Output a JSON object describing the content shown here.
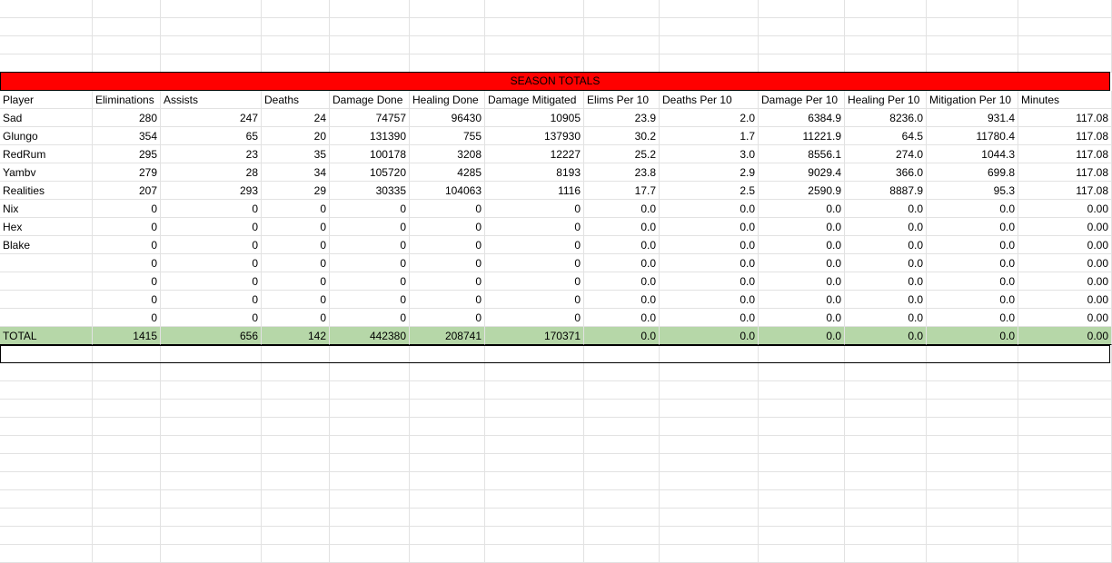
{
  "banner": "SEASON TOTALS",
  "headers": [
    "Player",
    "Eliminations",
    "Assists",
    "Deaths",
    "Damage Done",
    "Healing Done",
    "Damage Mitigated",
    "Elims Per 10",
    "Deaths Per 10",
    "Damage Per 10",
    "Healing Per 10",
    "Mitigation Per 10",
    "Minutes"
  ],
  "rows": [
    [
      "Sad",
      "280",
      "247",
      "24",
      "74757",
      "96430",
      "10905",
      "23.9",
      "2.0",
      "6384.9",
      "8236.0",
      "931.4",
      "117.08"
    ],
    [
      "Glungo",
      "354",
      "65",
      "20",
      "131390",
      "755",
      "137930",
      "30.2",
      "1.7",
      "11221.9",
      "64.5",
      "11780.4",
      "117.08"
    ],
    [
      "RedRum",
      "295",
      "23",
      "35",
      "100178",
      "3208",
      "12227",
      "25.2",
      "3.0",
      "8556.1",
      "274.0",
      "1044.3",
      "117.08"
    ],
    [
      "Yambv",
      "279",
      "28",
      "34",
      "105720",
      "4285",
      "8193",
      "23.8",
      "2.9",
      "9029.4",
      "366.0",
      "699.8",
      "117.08"
    ],
    [
      "Realities",
      "207",
      "293",
      "29",
      "30335",
      "104063",
      "1116",
      "17.7",
      "2.5",
      "2590.9",
      "8887.9",
      "95.3",
      "117.08"
    ],
    [
      "Nix",
      "0",
      "0",
      "0",
      "0",
      "0",
      "0",
      "0.0",
      "0.0",
      "0.0",
      "0.0",
      "0.0",
      "0.00"
    ],
    [
      "Hex",
      "0",
      "0",
      "0",
      "0",
      "0",
      "0",
      "0.0",
      "0.0",
      "0.0",
      "0.0",
      "0.0",
      "0.00"
    ],
    [
      "Blake",
      "0",
      "0",
      "0",
      "0",
      "0",
      "0",
      "0.0",
      "0.0",
      "0.0",
      "0.0",
      "0.0",
      "0.00"
    ],
    [
      "",
      "0",
      "0",
      "0",
      "0",
      "0",
      "0",
      "0.0",
      "0.0",
      "0.0",
      "0.0",
      "0.0",
      "0.00"
    ],
    [
      "",
      "0",
      "0",
      "0",
      "0",
      "0",
      "0",
      "0.0",
      "0.0",
      "0.0",
      "0.0",
      "0.0",
      "0.00"
    ],
    [
      "",
      "0",
      "0",
      "0",
      "0",
      "0",
      "0",
      "0.0",
      "0.0",
      "0.0",
      "0.0",
      "0.0",
      "0.00"
    ],
    [
      "",
      "0",
      "0",
      "0",
      "0",
      "0",
      "0",
      "0.0",
      "0.0",
      "0.0",
      "0.0",
      "0.0",
      "0.00"
    ]
  ],
  "totals": [
    "TOTAL",
    "1415",
    "656",
    "142",
    "442380",
    "208741",
    "170371",
    "0.0",
    "0.0",
    "0.0",
    "0.0",
    "0.0",
    "0.00"
  ],
  "colors": {
    "banner": "#ff0000",
    "totals": "#b6d7a8",
    "gridline": "#e2e2e2"
  }
}
